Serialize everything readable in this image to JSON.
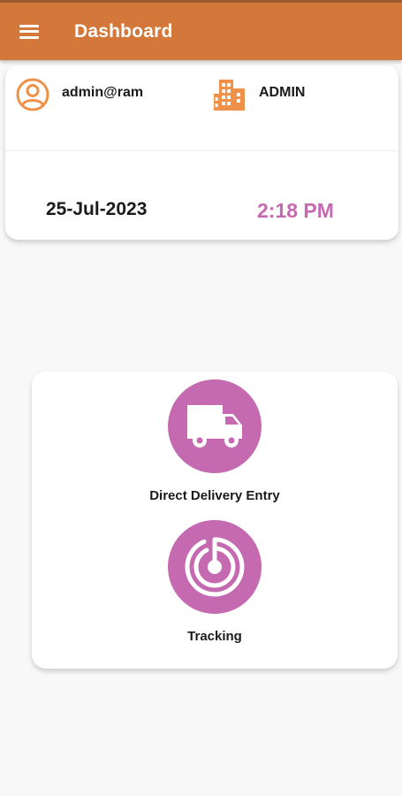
{
  "colors": {
    "appbar": "#d3783a",
    "accent_orange": "#f0914a",
    "accent_purple": "#c56ab1",
    "background": "#f8f8f8"
  },
  "appbar": {
    "menu_icon": "hamburger-menu-icon",
    "title": "Dashboard"
  },
  "info_card": {
    "user_icon": "user-circle-icon",
    "username": "admin@ram",
    "role_icon": "building-icon",
    "role": "ADMIN",
    "date": "25-Jul-2023",
    "time": "2:18 PM"
  },
  "menu": {
    "items": [
      {
        "label": "Direct Delivery Entry",
        "icon": "truck-icon"
      },
      {
        "label": "Tracking",
        "icon": "tracking-radar-icon"
      }
    ]
  }
}
